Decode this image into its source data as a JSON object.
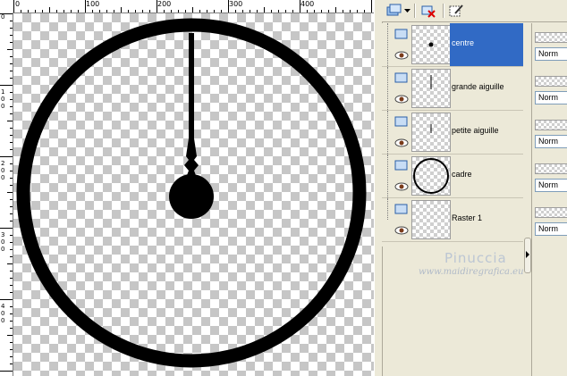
{
  "ruler": {
    "top_labels": [
      "0",
      "100",
      "200",
      "300",
      "400"
    ],
    "left_labels": [
      {
        "digits": [
          "0"
        ]
      },
      {
        "digits": [
          "1",
          "0",
          "0"
        ]
      },
      {
        "digits": [
          "2",
          "0",
          "0"
        ]
      },
      {
        "digits": [
          "3",
          "0",
          "0"
        ]
      },
      {
        "digits": [
          "4",
          "0",
          "0"
        ]
      }
    ]
  },
  "toolbar": {
    "icons": [
      "new-layer-icon",
      "dropdown-arrow-icon",
      "delete-layer-icon",
      "edit-mask-icon"
    ]
  },
  "layers": [
    {
      "name": "centre",
      "selected": true,
      "thumb": "dot"
    },
    {
      "name": "grande aiguille",
      "selected": false,
      "thumb": "long-line"
    },
    {
      "name": "petite aiguille",
      "selected": false,
      "thumb": "short-line"
    },
    {
      "name": "cadre",
      "selected": false,
      "thumb": "circle"
    },
    {
      "name": "Raster 1",
      "selected": false,
      "thumb": "empty"
    }
  ],
  "blend_modes": [
    "Norm",
    "Norm",
    "Norm",
    "Norm",
    "Norm"
  ],
  "watermark": {
    "name": "Pinuccia",
    "url": "www.maidiregrafica.eu"
  },
  "colors": {
    "selection": "#316ac5",
    "panel_bg": "#ece9d8",
    "ink": "#000000"
  }
}
